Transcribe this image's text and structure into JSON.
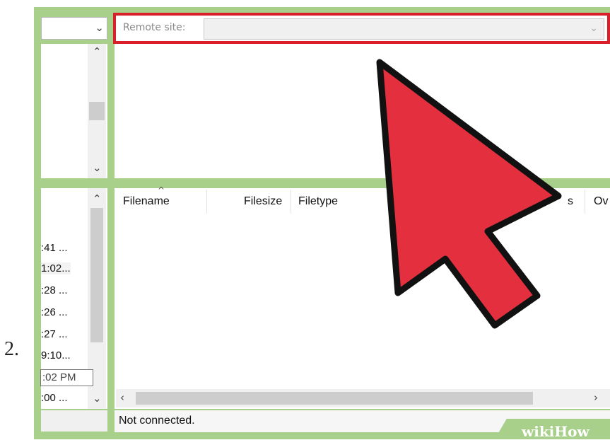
{
  "step_number": "2.",
  "remote_site": {
    "label": "Remote site:",
    "value": ""
  },
  "left_lower": {
    "times": [
      ":41 ...",
      "1:02...",
      ":28 ...",
      ":26 ...",
      ":27 ...",
      "9:10...",
      ":00 ..."
    ],
    "tooltip": ":02 PM"
  },
  "file_list": {
    "columns": [
      "Filename",
      "Filesize",
      "Filetype",
      "s",
      "Ov"
    ]
  },
  "status_text": "Not connected.",
  "watermark": {
    "part1": "wiki",
    "part2": "How"
  },
  "colors": {
    "frame_green": "#a9d08b",
    "highlight_red": "#d9202a",
    "arrow_red": "#e4303e"
  },
  "icons": [
    "chevron-down-icon",
    "chevron-up-icon",
    "chevron-left-icon",
    "chevron-right-icon",
    "sort-ascending-icon",
    "arrow-pointer-icon"
  ]
}
